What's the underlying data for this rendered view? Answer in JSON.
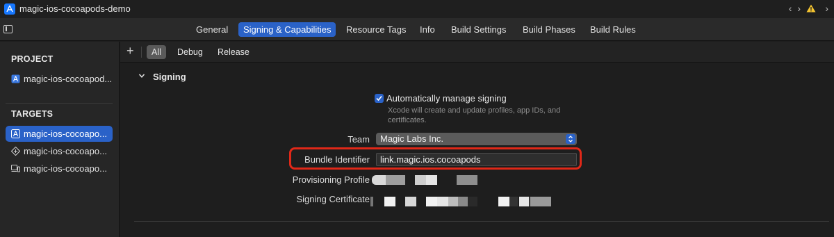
{
  "window": {
    "project_name": "magic-ios-cocoapods-demo"
  },
  "tabs": [
    {
      "label": "General"
    },
    {
      "label": "Signing & Capabilities"
    },
    {
      "label": "Resource Tags"
    },
    {
      "label": "Info"
    },
    {
      "label": "Build Settings"
    },
    {
      "label": "Build Phases"
    },
    {
      "label": "Build Rules"
    }
  ],
  "active_tab": "Signing & Capabilities",
  "sidebar": {
    "project_heading": "PROJECT",
    "project_item": "magic-ios-cocoapod...",
    "targets_heading": "TARGETS",
    "targets": [
      {
        "label": "magic-ios-cocoapo...",
        "icon": "app-target-icon",
        "selected": true
      },
      {
        "label": "magic-ios-cocoapo...",
        "icon": "test-target-icon",
        "selected": false
      },
      {
        "label": "magic-ios-cocoapo...",
        "icon": "ui-test-target-icon",
        "selected": false
      }
    ]
  },
  "filter": {
    "items": [
      {
        "label": "All"
      },
      {
        "label": "Debug"
      },
      {
        "label": "Release"
      }
    ],
    "active": "All"
  },
  "signing": {
    "title": "Signing",
    "auto_manage_label": "Automatically manage signing",
    "auto_manage_checked": true,
    "auto_manage_help": "Xcode will create and update profiles, app IDs, and certificates.",
    "team_label": "Team",
    "team_value": "Magic Labs Inc.",
    "bundle_label": "Bundle Identifier",
    "bundle_value": "link.magic.ios.cocoapods",
    "profile_label": "Provisioning Profile",
    "certificate_label": "Signing Certificate"
  },
  "colors": {
    "accent": "#2a62c8",
    "highlight": "#e02818",
    "warning": "#f4c430"
  }
}
